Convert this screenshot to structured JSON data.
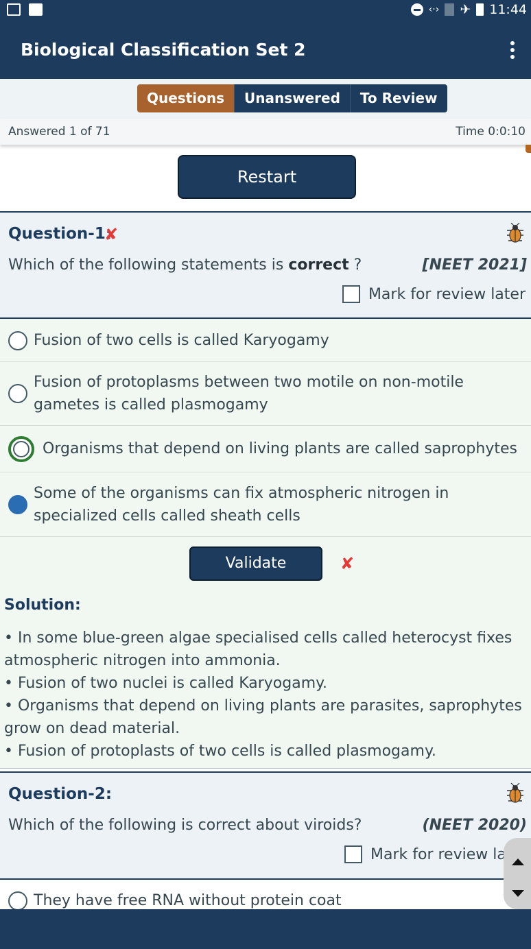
{
  "status_bar": {
    "time": "11:44"
  },
  "app_bar": {
    "title": "Biological Classification Set 2"
  },
  "tabs": [
    {
      "label": "Questions",
      "active": true
    },
    {
      "label": "Unanswered",
      "active": false
    },
    {
      "label": "To Review",
      "active": false
    }
  ],
  "info": {
    "answered": "Answered 1 of 71",
    "time": "Time 0:0:10"
  },
  "restart_label": "Restart",
  "q1": {
    "label": "Question-1:",
    "status_mark": "✘",
    "text_before": "Which of the following statements is ",
    "text_bold": "correct",
    "text_after": " ?",
    "exam": "[NEET 2021]",
    "review_label": "Mark for review later",
    "options": [
      {
        "text": "Fusion of two cells is called Karyogamy",
        "state": "none"
      },
      {
        "text": "Fusion of protoplasms between two motile on non-motile gametes is called plasmogamy",
        "state": "none"
      },
      {
        "text": "Organisms that depend on living plants are called saprophytes",
        "state": "correct"
      },
      {
        "text": "Some of the organisms can fix atmospheric nitrogen in specialized cells called sheath cells",
        "state": "selected"
      }
    ],
    "validate_label": "Validate",
    "validate_mark": "✘",
    "solution_title": "Solution:",
    "solution_lines": [
      "• In some blue-green algae specialised cells called heterocyst fixes atmospheric nitrogen into ammonia.",
      "• Fusion of two nuclei is called Karyogamy.",
      "• Organisms that depend on living plants are parasites, saprophytes grow on dead material.",
      "• Fusion of protoplasts of two cells is called plasmogamy."
    ]
  },
  "q2": {
    "label": "Question-2:",
    "text": "Which of the following is correct about viroids?",
    "exam": "(NEET 2020)",
    "review_label": "Mark for review later",
    "options": [
      {
        "text": "They have free RNA without protein coat",
        "state": "none"
      }
    ]
  },
  "colors": {
    "primary": "#1d3b5c",
    "accent": "#a8622e",
    "error": "#e53935",
    "correct": "#2e7d32",
    "selected": "#2a6db2"
  }
}
